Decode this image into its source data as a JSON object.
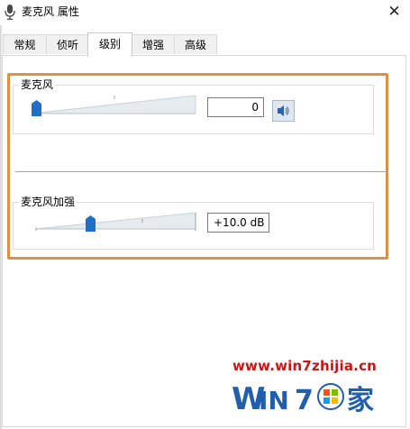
{
  "window": {
    "title": "麦克风 属性",
    "close_glyph": "✕"
  },
  "tabs": [
    {
      "label": "常规"
    },
    {
      "label": "侦听"
    },
    {
      "label": "级别",
      "active": true
    },
    {
      "label": "增强"
    },
    {
      "label": "高级"
    }
  ],
  "levels": {
    "microphone": {
      "label": "麦克风",
      "value": "0",
      "slider_level": 0,
      "speaker_icon": "speaker-icon"
    },
    "boost": {
      "label": "麦克风加强",
      "value": "+10.0 dB",
      "slider_level": 0.33
    }
  },
  "colors": {
    "highlight_frame": "#e38f3f",
    "slider_thumb": "#1f6fc4",
    "watermark_text": "#d11212",
    "logo_blue": "#1f5fae"
  },
  "watermark": {
    "url": "www.win7zhijia.cn",
    "logo_text": "Win7之家"
  }
}
